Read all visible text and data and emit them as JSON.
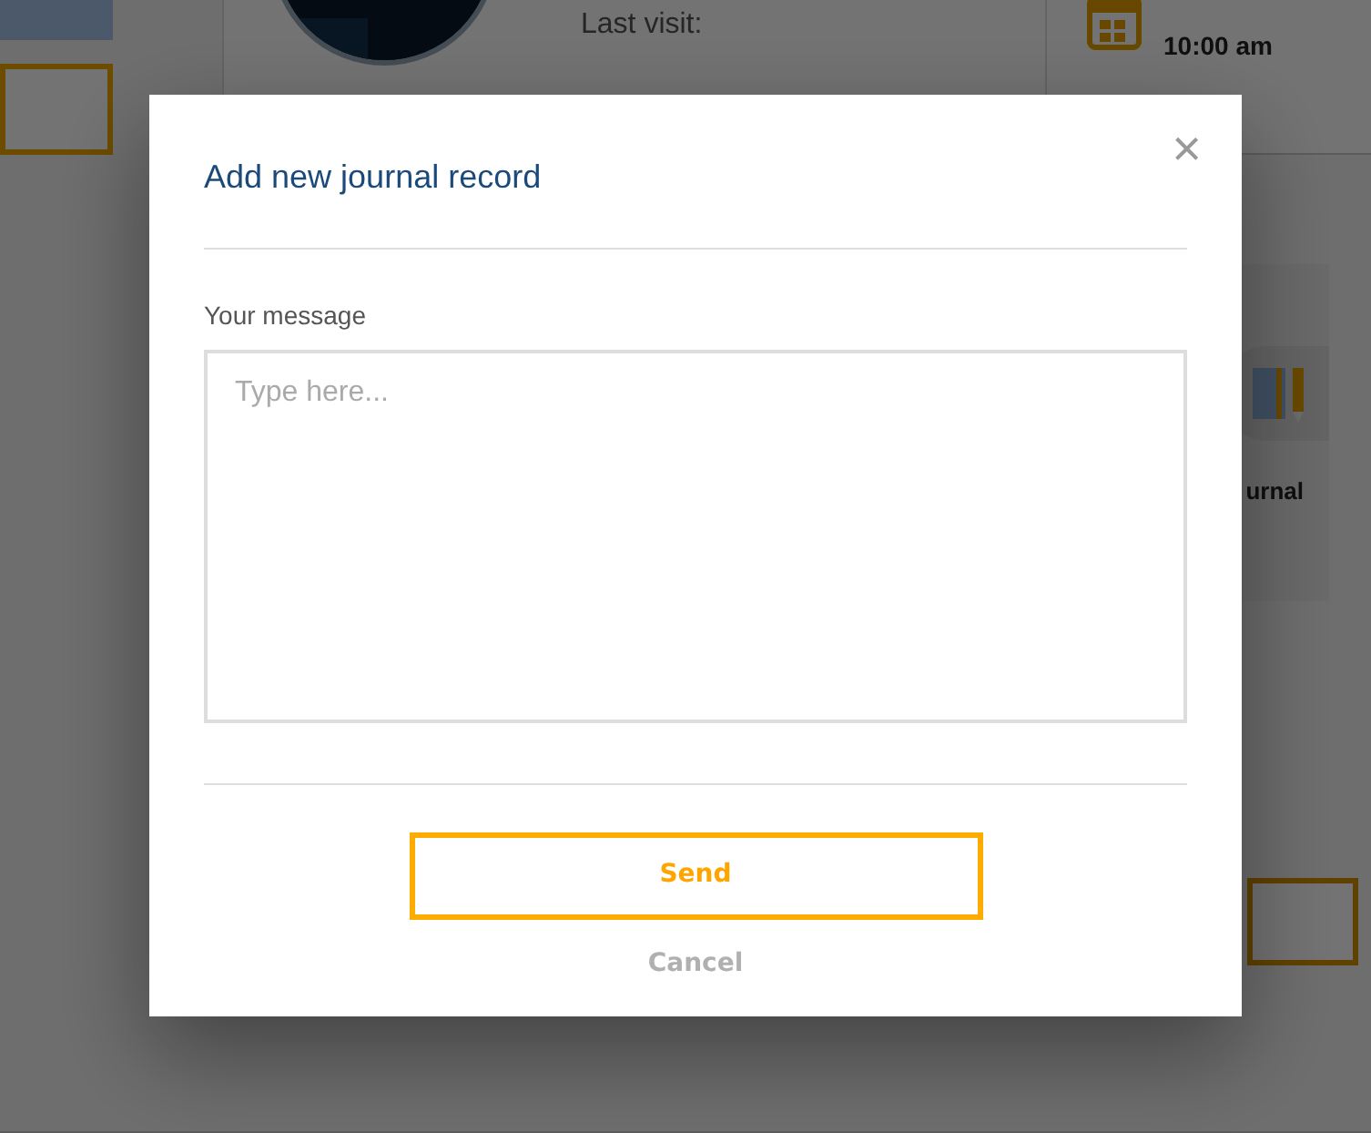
{
  "background": {
    "last_visit_label": "Last visit:",
    "appointment": {
      "time": "10:00 am"
    },
    "journal_tile": {
      "label": "urnal"
    }
  },
  "modal": {
    "title": "Add new journal record",
    "close": "×",
    "field": {
      "label": "Your message",
      "placeholder": "Type here..."
    },
    "buttons": [
      {
        "label": "Send",
        "kind": "primary"
      },
      {
        "label": "Cancel",
        "kind": "link"
      }
    ]
  }
}
